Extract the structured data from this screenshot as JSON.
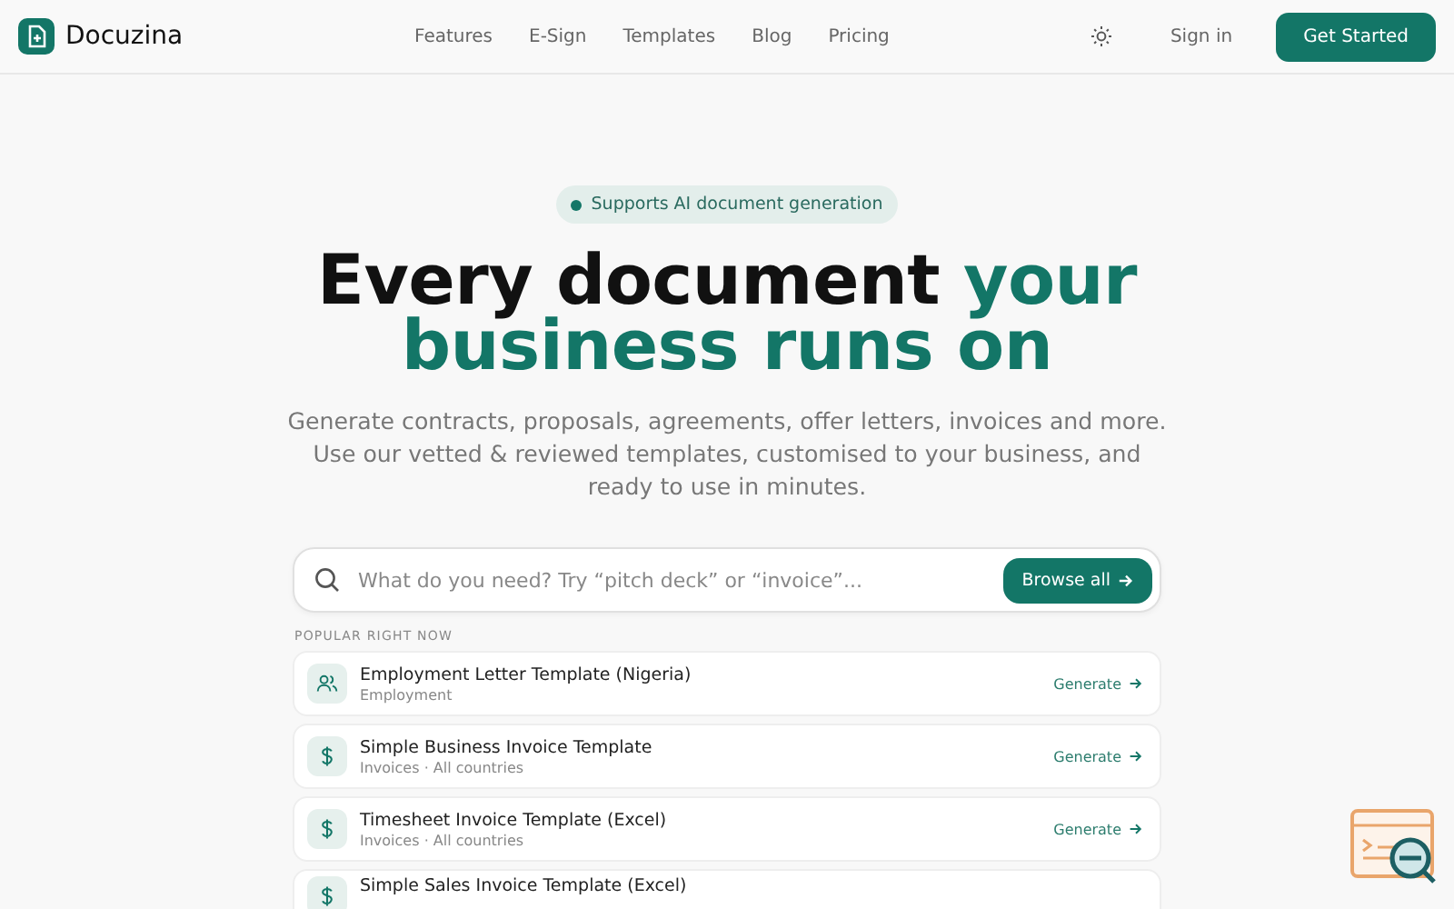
{
  "brand": {
    "name": "Docuzina"
  },
  "nav": [
    {
      "label": "Features"
    },
    {
      "label": "E-Sign"
    },
    {
      "label": "Templates"
    },
    {
      "label": "Blog"
    },
    {
      "label": "Pricing"
    }
  ],
  "header_actions": {
    "sign_in": "Sign in",
    "cta": "Get Started"
  },
  "badge": "Supports AI document generation",
  "headline": {
    "dark": "Every document",
    "accent": "your business runs on"
  },
  "intro": "Generate contracts, proposals, agreements, offer letters, invoices and more. Use our vetted & reviewed templates, customised to your business, and ready to use in minutes.",
  "search": {
    "placeholder": "What do you need? Try “pitch deck” or “invoice”...",
    "button": "Browse all"
  },
  "popular": {
    "heading": "POPULAR RIGHT NOW",
    "items": [
      {
        "kind": "people",
        "title": "Employment Letter Template (Nigeria)",
        "subtitle": "Employment",
        "action": "Generate"
      },
      {
        "kind": "dollar",
        "title": "Simple Business Invoice Template",
        "subtitle": "Invoices · All countries",
        "action": "Generate"
      },
      {
        "kind": "dollar",
        "title": "Timesheet Invoice Template (Excel)",
        "subtitle": "Invoices · All countries",
        "action": "Generate"
      },
      {
        "kind": "dollar",
        "title": "Simple Sales Invoice Template (Excel)"
      }
    ]
  }
}
